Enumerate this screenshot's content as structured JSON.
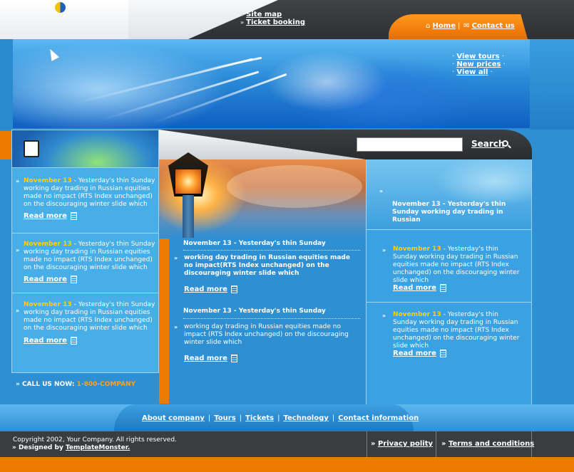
{
  "header": {
    "top_links": [
      "Site map",
      "Ticket booking"
    ],
    "home_label": "Home",
    "contact_label": "Contact us"
  },
  "banner": {
    "links": [
      "View tours",
      "New prices",
      "View all"
    ]
  },
  "left_news": [
    {
      "date": "November 13",
      "text": " - Yesterday's thin Sunday working day trading in Russian equities made no impact (RTS Index unchanged) on the discouraging winter slide which",
      "readmore": "Read more"
    },
    {
      "date": "November 13",
      "text": " - Yesterday's thin Sunday working day trading in Russian equities made no impact (RTS Index unchanged) on the discouraging winter slide which",
      "readmore": "Read more"
    },
    {
      "date": "November 13",
      "text": " - Yesterday's thin Sunday working day trading in Russian equities made no impact (RTS Index unchanged) on the discouraging winter slide which",
      "readmore": "Read more"
    }
  ],
  "call": {
    "label": "CALL US NOW: ",
    "number": "1-800-COMPANY"
  },
  "search": {
    "placeholder": "",
    "button": "Search"
  },
  "center_news": [
    {
      "title": "November 13 - Yesterday's thin Sunday",
      "text": "working day trading in Russian equities made no impact(RTS Index unchanged) on the discouraging winter slide which",
      "readmore": "Read more"
    },
    {
      "title": "November 13 - Yesterday's thin Sunday",
      "text": "working day trading in Russian equities made no impact (RTS Index unchanged) on the discouraging winter slide which",
      "readmore": "Read more"
    }
  ],
  "right_top": {
    "title": "November 13 - Yesterday's thin Sunday working day trading in Russian"
  },
  "right_news": [
    {
      "date": "November 13",
      "text": " - Yesterday's thin Sunday working day trading in Russian equities made no impact (RTS Index unchanged) on the discouraging winter slide which",
      "readmore": "Read more"
    },
    {
      "date": "November 13",
      "text": " - Yesterday's thin Sunday working day trading in Russian equities made no impact (RTS Index unchanged) on the discouraging winter slide which",
      "readmore": "Read more"
    }
  ],
  "footer": {
    "links": [
      "About company",
      "Tours",
      "Tickets",
      "Technology",
      "Contact information"
    ],
    "copyright": "Copyright 2002, Your Company. All rights reserved.",
    "designed_by_label": "Designed by ",
    "designed_by_link": "TemplateMonster.",
    "privacy": "Privacy polity",
    "terms": "Terms and conditions"
  },
  "colors": {
    "accent_orange": "#ee7a00",
    "news_date_yellow": "#ffd200",
    "background_blue": "#2f8fd3"
  }
}
